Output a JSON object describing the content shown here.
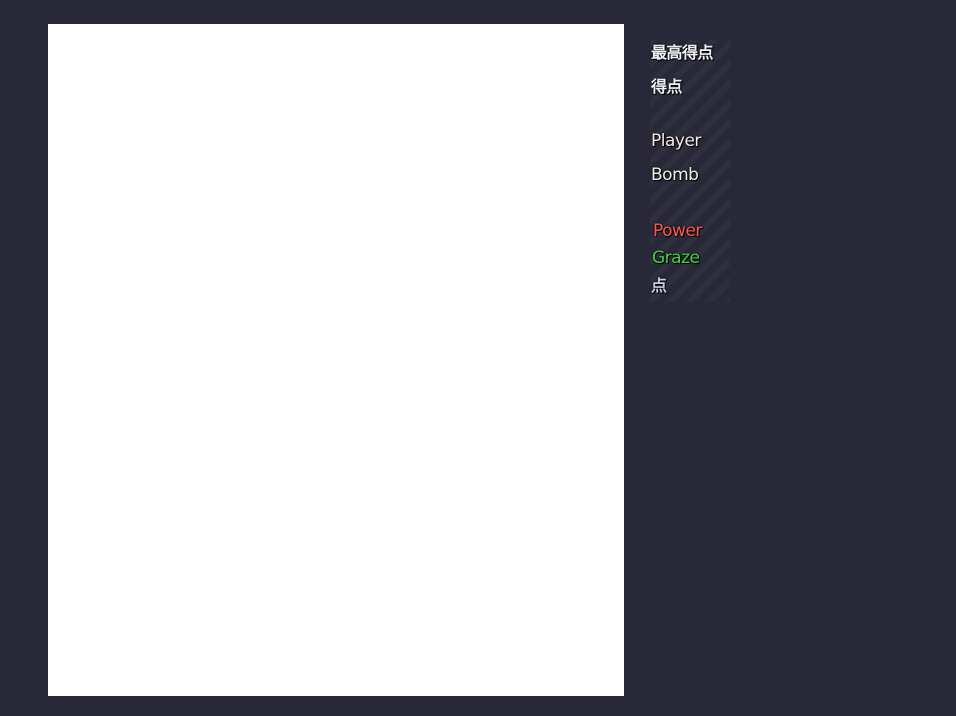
{
  "hud": {
    "hiscore_label": "最高得点",
    "score_label": "得点",
    "player_label": "Player",
    "bomb_label": "Bomb",
    "power_label": "Power",
    "graze_label": "Graze",
    "point_label": "点"
  },
  "colors": {
    "background": "#282838",
    "playfield": "#ffffff",
    "power": "#ff5a48",
    "graze": "#44d044"
  }
}
